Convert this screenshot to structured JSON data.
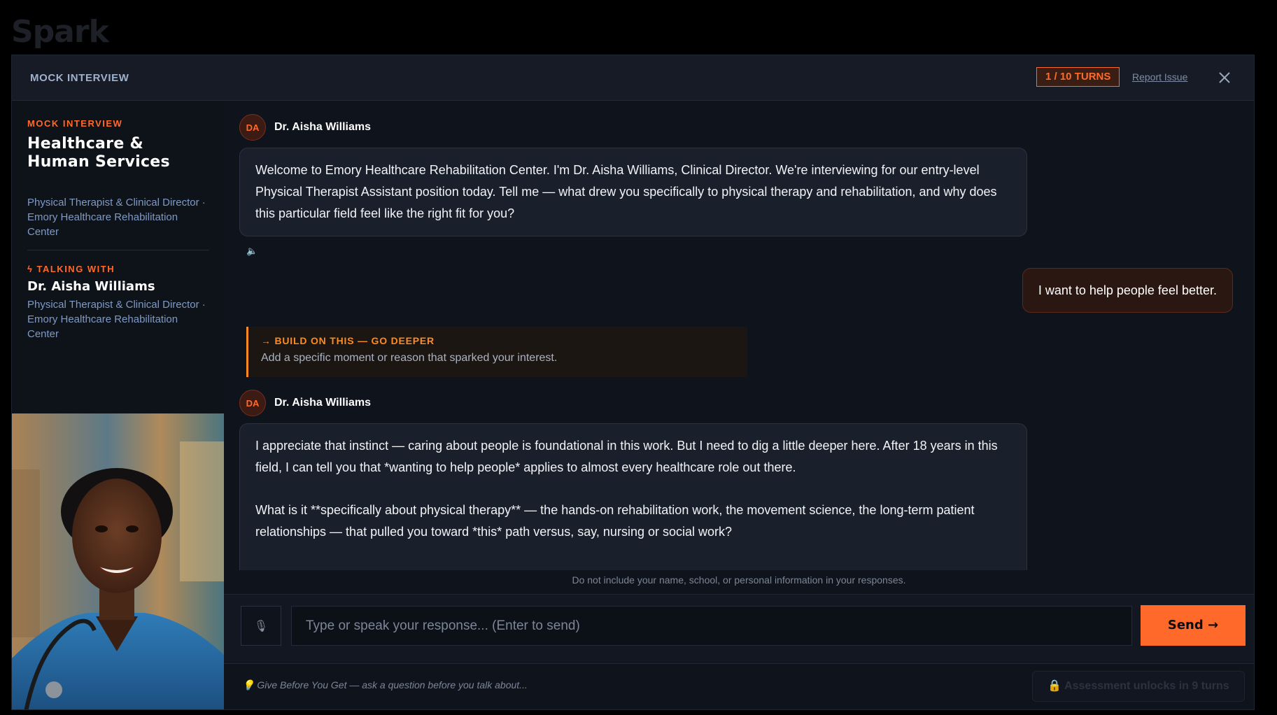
{
  "app": {
    "brand": "Spark"
  },
  "topbar": {
    "title": "MOCK INTERVIEW",
    "turns": "1 / 10 TURNS",
    "report": "Report Issue",
    "close_icon": "close-icon"
  },
  "sidebar": {
    "eyebrow": "MOCK INTERVIEW",
    "title": "Healthcare & Human Services",
    "subtitle": "Physical Therapist & Clinical Director · Emory Healthcare Rehabilitation Center",
    "talking_label": "TALKING WITH",
    "interviewer_name": "Dr. Aisha Williams",
    "interviewer_role": "Physical Therapist & Clinical Director · Emory Healthcare Rehabilitation Center",
    "portrait_icon": "interviewer-portrait"
  },
  "chat": {
    "messages": [
      {
        "initials": "DA",
        "name": "Dr. Aisha Williams",
        "text": "Welcome to Emory Healthcare Rehabilitation Center. I'm Dr. Aisha Williams, Clinical Director. We're interviewing for our entry-level Physical Therapist Assistant position today. Tell me — what drew you specifically to physical therapy and rehabilitation, and why does this particular field feel like the right fit for you?",
        "speaker_icon": "🔈"
      },
      {
        "user_text": "I want to help people feel better."
      },
      {
        "coach_title": "→ BUILD ON THIS — GO DEEPER",
        "coach_text": "Add a specific moment or reason that sparked your interest."
      },
      {
        "initials": "DA",
        "name": "Dr. Aisha Williams",
        "para1": "I appreciate that instinct — caring about people is foundational in this work. But I need to dig a little deeper here. After 18 years in this field, I can tell you that *wanting to help people* applies to almost every healthcare role out there.",
        "para2": "What is it **specifically about physical therapy** — the hands-on rehabilitation work, the movement science, the long-term patient relationships — that pulled you toward *this* path versus, say, nursing or social work?"
      }
    ]
  },
  "disclaimer": "Do not include your name, school, or personal information in your responses.",
  "composer": {
    "mic_icon": "🎙",
    "placeholder": "Type or speak your response... (Enter to send)",
    "send_label": "Send →"
  },
  "footer": {
    "tip": "💡 Give Before You Get — ask a question before you talk about...",
    "locked_label": "🔒 Assessment unlocks in 9 turns"
  },
  "colors": {
    "accent": "#ff6a2b",
    "coach": "#ff8a1f",
    "panel": "#1a202b"
  }
}
